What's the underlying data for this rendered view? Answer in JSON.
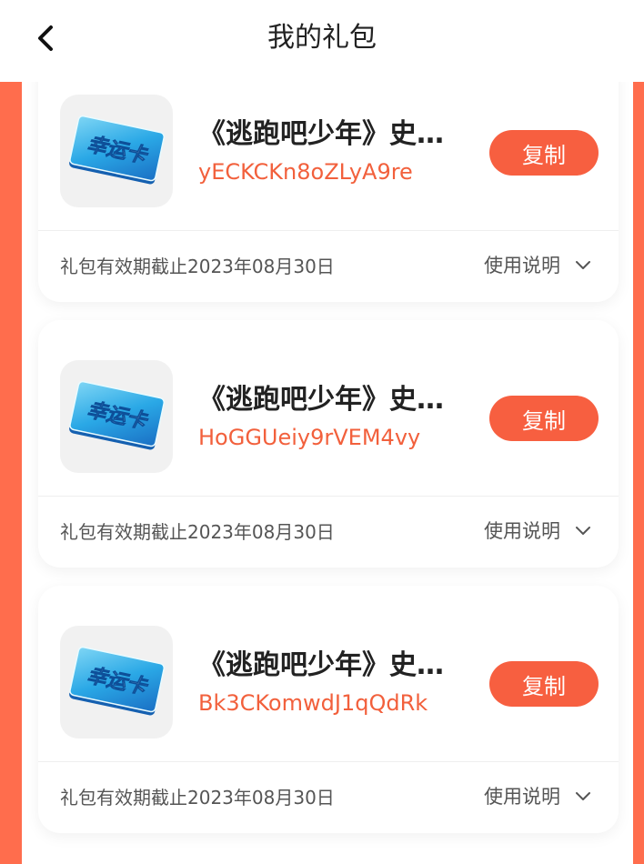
{
  "header": {
    "back_icon": "chevron-left-icon",
    "title": "我的礼包"
  },
  "colors": {
    "accent": "#f75f40",
    "band": "#ff6d4d",
    "code_text": "#f2603c"
  },
  "gifts": [
    {
      "thumb_text": "幸运卡",
      "title": "《逃跑吧少年》史诗礼包",
      "code": "yECKCKn8oZLyA9re",
      "copy_label": "复制",
      "expiry": "礼包有效期截止2023年08月30日",
      "usage_label": "使用说明",
      "usage_icon": "chevron-down-icon"
    },
    {
      "thumb_text": "幸运卡",
      "title": "《逃跑吧少年》史诗礼包",
      "code": "HoGGUeiy9rVEM4vy",
      "copy_label": "复制",
      "expiry": "礼包有效期截止2023年08月30日",
      "usage_label": "使用说明",
      "usage_icon": "chevron-down-icon"
    },
    {
      "thumb_text": "幸运卡",
      "title": "《逃跑吧少年》史诗礼包",
      "code": "Bk3CKomwdJ1qQdRk",
      "copy_label": "复制",
      "expiry": "礼包有效期截止2023年08月30日",
      "usage_label": "使用说明",
      "usage_icon": "chevron-down-icon"
    }
  ]
}
